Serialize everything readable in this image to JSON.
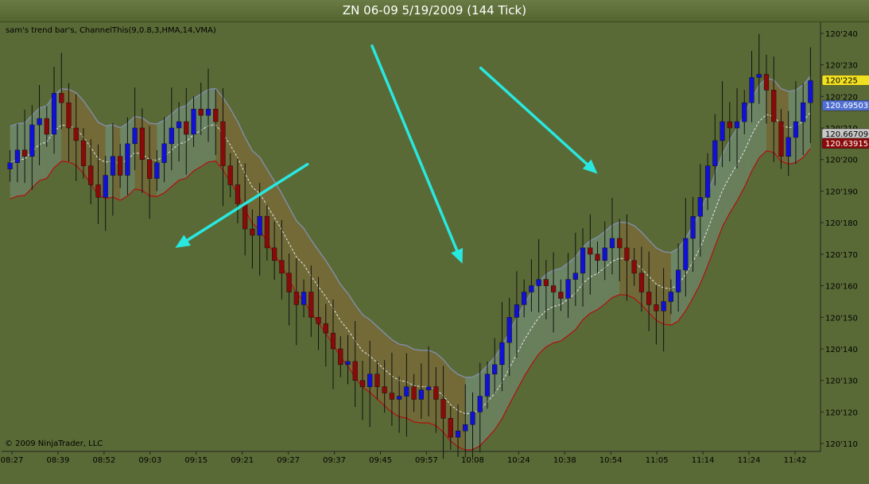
{
  "window": {
    "title": "ZN 06-09  5/19/2009 (144 Tick)"
  },
  "indicator_label": "sam's trend bar's, ChannelThis(9,0.8,3,HMA,14,VMA)",
  "copyright": "© 2009 NinjaTrader, LLC",
  "colors": {
    "background": "#5a6a36",
    "up_bar": "#1010d8",
    "down_bar": "#8a0a0a",
    "neutral_bar": "#b8b830",
    "band_up_fill": "#7c9a8a",
    "band_down_fill": "#8a6a3a",
    "arrow": "#28e8e0",
    "upper_line": "#7f8fa8",
    "lower_line": "#b01010",
    "mid_line": "#e6e6e6"
  },
  "badges": [
    {
      "text": "120'225",
      "price": 120.225,
      "bg": "#f0e020",
      "fg": "#000000"
    },
    {
      "text": "120.69503",
      "price": 120.217,
      "bg": "#5070d0",
      "fg": "#ffffff"
    },
    {
      "text": "120.66709",
      "price": 120.208,
      "bg": "#c8c8c8",
      "fg": "#000000"
    },
    {
      "text": "120.63915",
      "price": 120.205,
      "bg": "#8a0a0a",
      "fg": "#ffffff"
    }
  ],
  "chart_data": {
    "type": "candlestick",
    "title": "ZN 06-09  5/19/2009 (144 Tick)",
    "x_tick_labels": [
      "08:27",
      "08:39",
      "08:52",
      "09:03",
      "09:15",
      "09:21",
      "09:27",
      "09:37",
      "09:45",
      "09:57",
      "10:08",
      "10:24",
      "10:38",
      "10:54",
      "11:05",
      "11:14",
      "11:24",
      "11:42"
    ],
    "y_tick_labels": [
      "120'110",
      "120'120",
      "120'130",
      "120'140",
      "120'150",
      "120'160",
      "120'170",
      "120'180",
      "120'190",
      "120'200",
      "120'210",
      "120'220",
      "120'230",
      "120'240"
    ],
    "ylim": [
      120.1075,
      120.2435
    ],
    "grid": false,
    "bar_count": 110,
    "closes": [
      120.199,
      120.203,
      120.201,
      120.211,
      120.213,
      120.208,
      120.221,
      120.218,
      120.21,
      120.206,
      120.198,
      120.192,
      120.188,
      120.195,
      120.201,
      120.195,
      120.205,
      120.21,
      120.2,
      120.194,
      120.199,
      120.205,
      120.21,
      120.212,
      120.208,
      120.216,
      120.214,
      120.216,
      120.212,
      120.198,
      120.192,
      120.186,
      120.178,
      120.176,
      120.182,
      120.172,
      120.168,
      120.164,
      120.158,
      120.154,
      120.158,
      120.15,
      120.148,
      120.145,
      120.14,
      120.135,
      120.136,
      120.13,
      120.128,
      120.132,
      120.128,
      120.126,
      120.124,
      120.125,
      120.128,
      120.124,
      120.127,
      120.128,
      120.124,
      120.118,
      120.112,
      120.114,
      120.116,
      120.12,
      120.125,
      120.132,
      120.135,
      120.142,
      120.15,
      120.154,
      120.158,
      120.16,
      120.162,
      120.16,
      120.158,
      120.156,
      120.162,
      120.164,
      120.172,
      120.17,
      120.168,
      120.172,
      120.175,
      120.172,
      120.168,
      120.164,
      120.158,
      120.154,
      120.152,
      120.155,
      120.158,
      120.165,
      120.175,
      120.182,
      120.188,
      120.198,
      120.206,
      120.212,
      120.21,
      120.212,
      120.218,
      120.226,
      120.227,
      120.222,
      120.212,
      120.201,
      120.207,
      120.212,
      120.218,
      120.225
    ],
    "arrows": [
      {
        "from": [
          40.5,
          120.1985
        ],
        "to": [
          22.5,
          120.172
        ]
      },
      {
        "from": [
          49.3,
          120.236
        ],
        "to": [
          61.6,
          120.167
        ]
      },
      {
        "from": [
          64.1,
          120.229
        ],
        "to": [
          80.0,
          120.1955
        ]
      }
    ]
  }
}
